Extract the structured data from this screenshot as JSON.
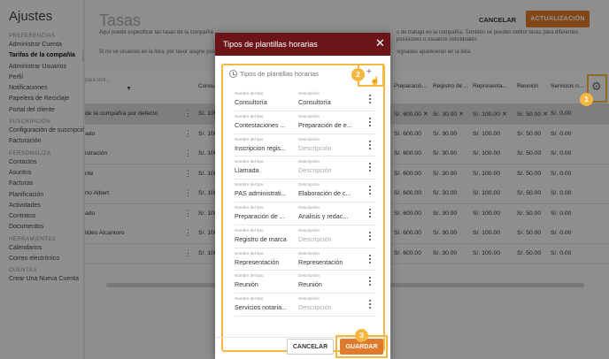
{
  "sidebar": {
    "title": "Ajustes",
    "sections": [
      {
        "heading": "PREFERENCIAS",
        "items": [
          "Administrar Cuenta",
          "Tarifas de la compañía",
          "Administrar Usuarios",
          "Perfil",
          "Notificaciones",
          "Papelera de Reciclaje",
          "Portal del cliente"
        ],
        "active": 1
      },
      {
        "heading": "SUSCRIPCIÓN",
        "items": [
          "Configuración de suscripción",
          "Facturación"
        ]
      },
      {
        "heading": "PERSONALIZA",
        "items": [
          "Contactos",
          "Asuntos",
          "Facturas",
          "Planificación",
          "Actividades",
          "Contratos",
          "Documentos"
        ]
      },
      {
        "heading": "HERRAMIENTAS",
        "items": [
          "Calendarios",
          "Correo electrónico"
        ]
      },
      {
        "heading": "CUENTAS",
        "items": [
          "Crear Una Nueva Cuenta"
        ]
      }
    ]
  },
  "page": {
    "title": "Tasas",
    "desc_left": "Aquí puede especificar las tasas de la compañía",
    "desc_right": "s de trabajo en la compañía. También se pueden definir tasas para diferentes posiciones o usuarios individuales",
    "desc2_left": "Si no ve usuarios en la lista, por favor asigne posic",
    "desc2_right": "signadas aparecerán en la lista.",
    "cancel": "CANCELAR",
    "update": "ACTUALIZACIÓN"
  },
  "table": {
    "filter_placeholder": "para teril...",
    "headers": [
      "Consult",
      "Preparació...",
      "Registro de ...",
      "Representa...",
      "Reunión",
      "Servicios n..."
    ],
    "rows": [
      {
        "name": "de la compañía por defecto",
        "c1": "S/. 100",
        "c2": "S/. 600.00 ✕",
        "c3": "S/. 30.00 ✕",
        "c4": "S/. 100.00 ✕",
        "c5": "S/. 50.00 ✕",
        "c6": "S/. 0.00",
        "highlight": true
      },
      {
        "name": "ado",
        "c1": "S/. 100",
        "c2": "S/. 600.00",
        "c3": "S/. 30.00",
        "c4": "S/. 100.00",
        "c5": "S/. 50.00",
        "c6": "S/. 0.00"
      },
      {
        "name": "istración",
        "c1": "S/. 100",
        "c2": "S/. 600.00",
        "c3": "S/. 30.00",
        "c4": "S/. 100.00",
        "c5": "S/. 50.00",
        "c6": "S/. 0.00"
      },
      {
        "name": "nte",
        "c1": "S/. 100",
        "c2": "S/. 600.00",
        "c3": "S/. 30.00",
        "c4": "S/. 100.00",
        "c5": "S/. 50.00",
        "c6": "S/. 0.00"
      },
      {
        "name": "rto Albert",
        "c1": "S/. 100",
        "c2": "S/. 600.00",
        "c3": "S/. 30.00",
        "c4": "S/. 100.00",
        "c5": "S/. 50.00",
        "c6": "S/. 0.00"
      },
      {
        "name": "ado",
        "c1": "S/. 100",
        "c2": "S/. 600.00",
        "c3": "S/. 30.00",
        "c4": "S/. 100.00",
        "c5": "S/. 50.00",
        "c6": "S/. 0.00"
      },
      {
        "name": "itdes Alcantoro",
        "c1": "S/. 100",
        "c2": "S/. 600.00",
        "c3": "S/. 30.00",
        "c4": "S/. 100.00",
        "c5": "S/. 50.00",
        "c6": "S/. 0.00"
      },
      {
        "name": "",
        "c1": "S/. 100",
        "c2": "S/. 600.00",
        "c3": "S/. 30.00",
        "c4": "S/. 100.00",
        "c5": "S/. 50.00",
        "c6": "S/. 0.00"
      }
    ]
  },
  "dialog": {
    "title": "Tipos de plantillas horarias",
    "card_title": "Tipos de plantillas horarias",
    "add_symbol": "+",
    "name_label": "Nombre del tipo",
    "desc_label": "Descripción",
    "desc_placeholder": "Descripción",
    "items": [
      {
        "name": "Consultoría",
        "desc": "Consultoría"
      },
      {
        "name": "Contestaciones ...",
        "desc": "Preparación de e..."
      },
      {
        "name": "Inscripcion regis...",
        "desc": ""
      },
      {
        "name": "Llamada",
        "desc": ""
      },
      {
        "name": "PAS administrati...",
        "desc": "Elaboración de c..."
      },
      {
        "name": "Preparación de ...",
        "desc": "Analisis y redac..."
      },
      {
        "name": "Registro de marca",
        "desc": ""
      },
      {
        "name": "Representación",
        "desc": "Representación"
      },
      {
        "name": "Reunión",
        "desc": "Reunión"
      },
      {
        "name": "Servicios notaria...",
        "desc": ""
      }
    ],
    "cancel": "CANCELAR",
    "save": "GUARDAR"
  },
  "badges": [
    "1",
    "2",
    "3"
  ],
  "colors": {
    "accent": "#e07a2c",
    "dialog_header": "#6b1519",
    "highlight": "#f4b740"
  }
}
